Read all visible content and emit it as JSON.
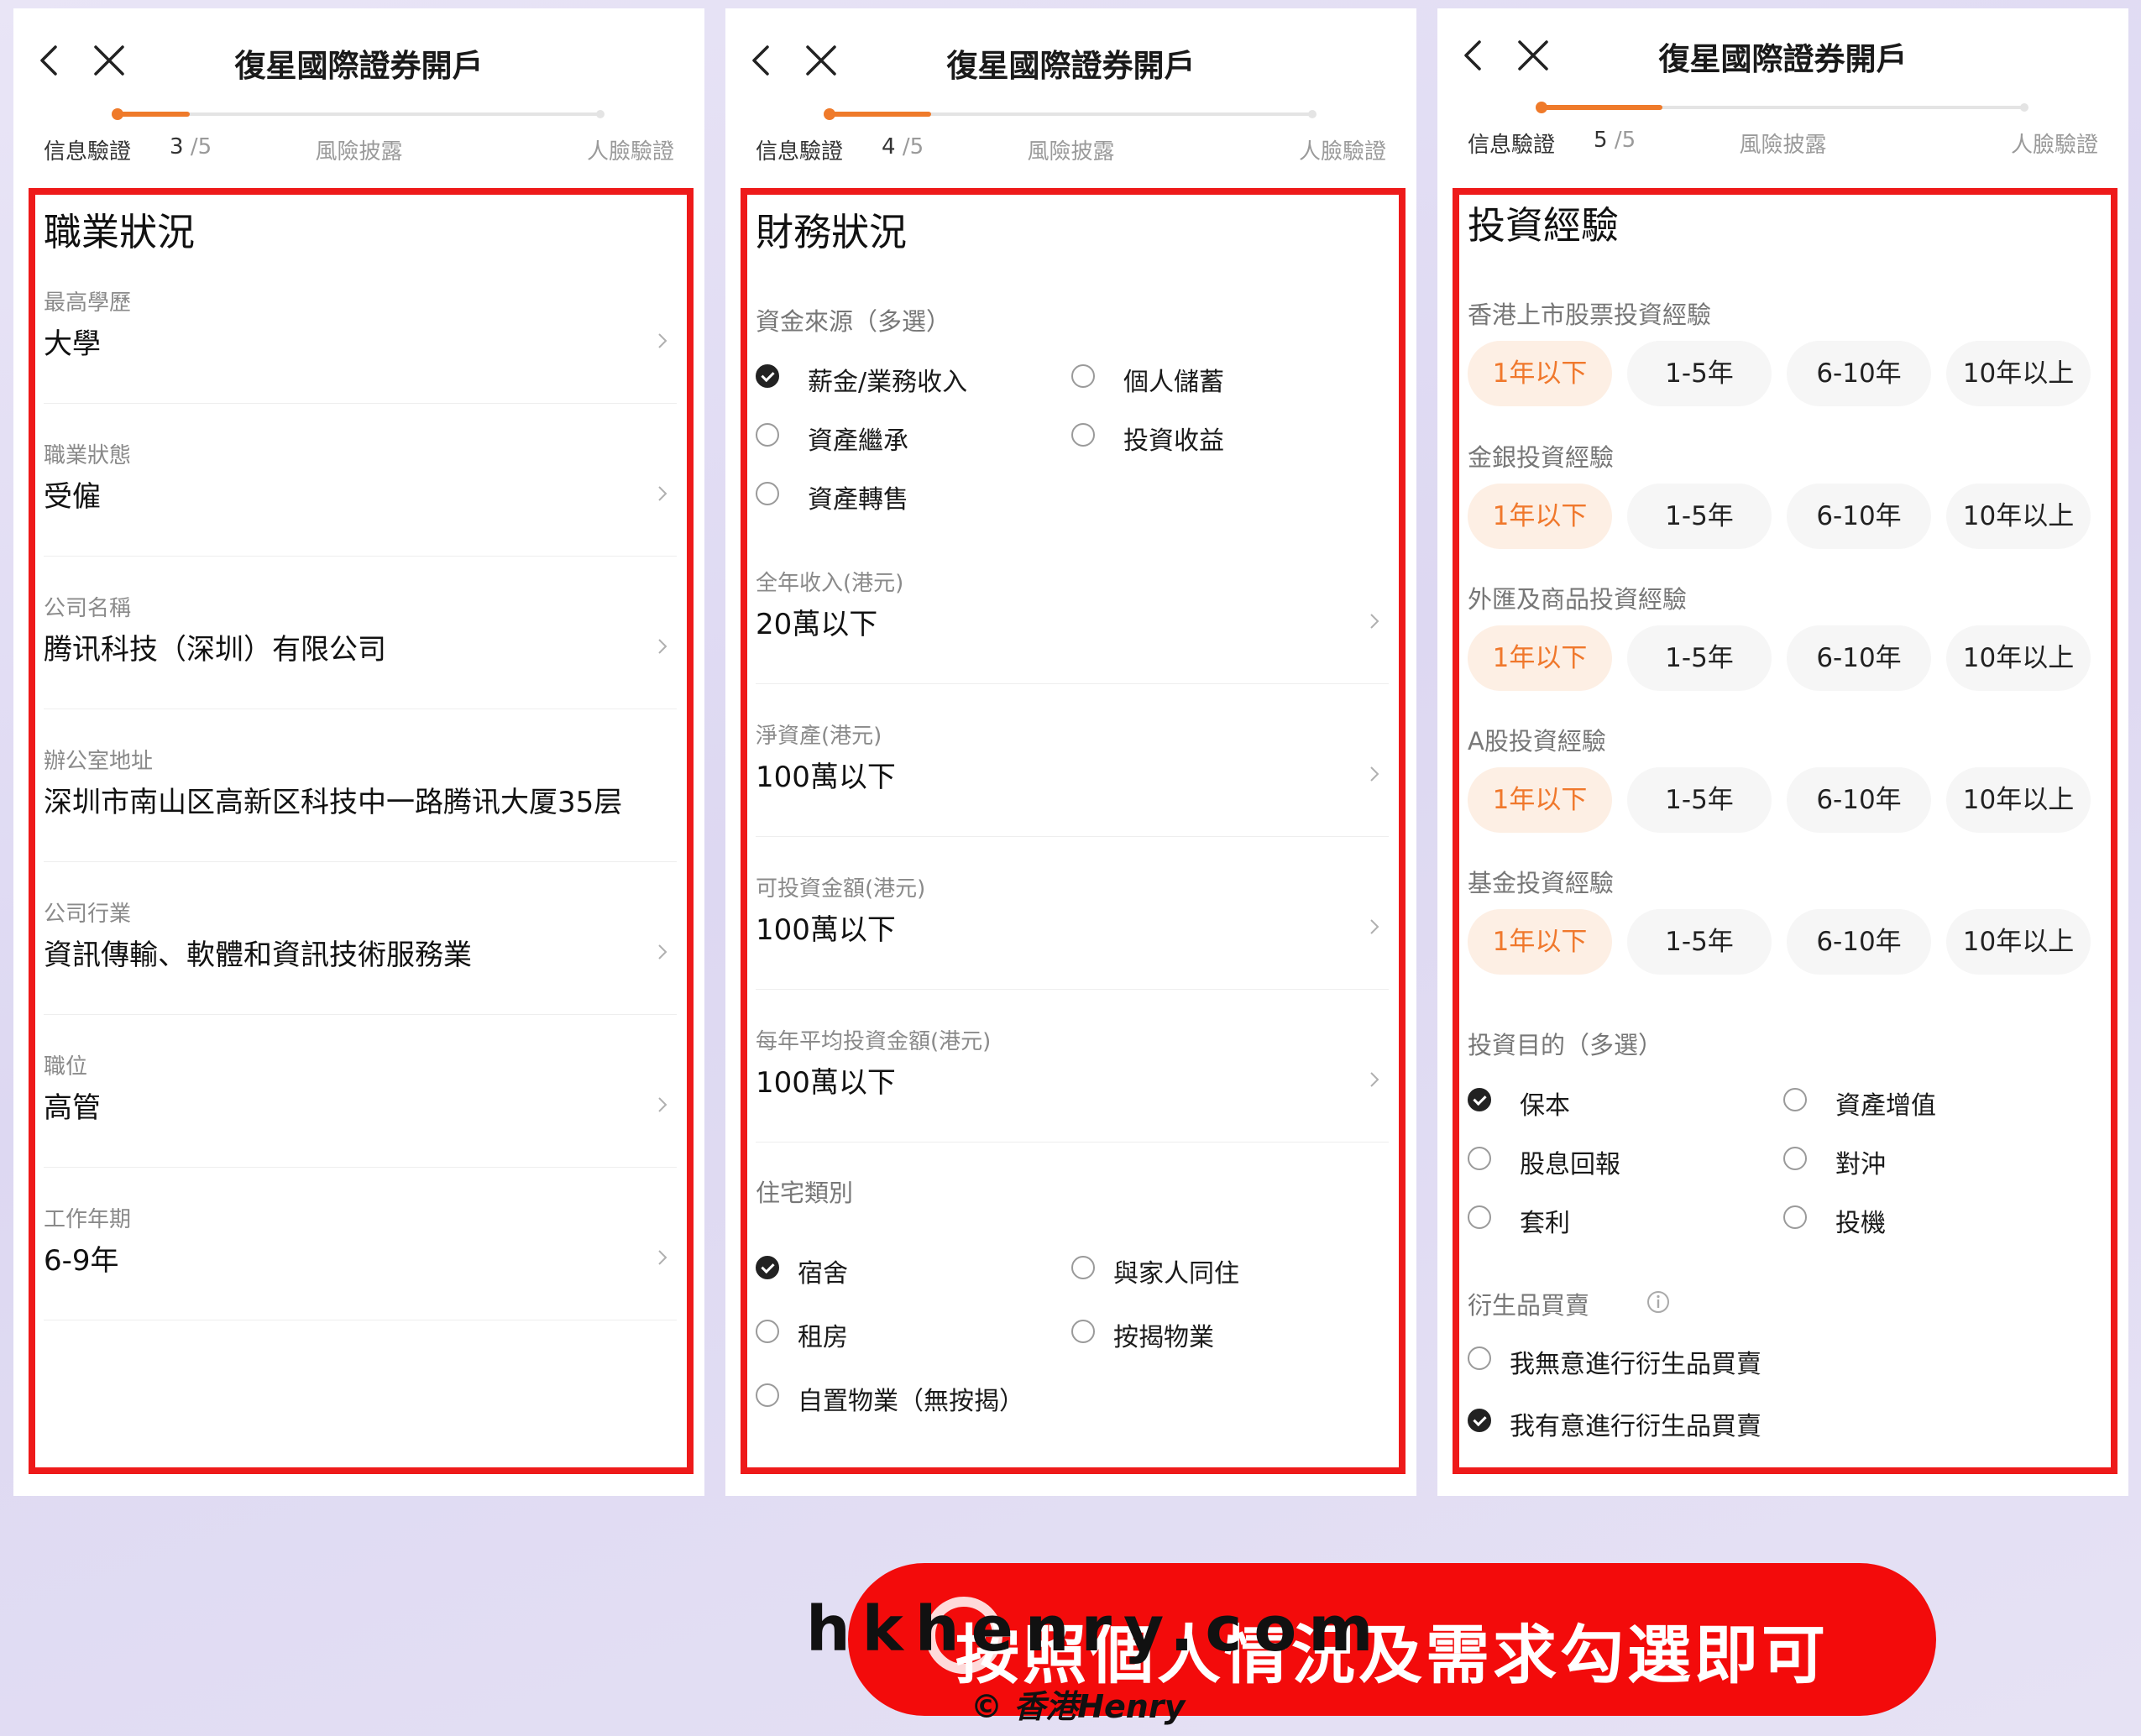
{
  "app_title": "復星國際證券開戶",
  "steps": {
    "step1": "信息驗證",
    "step2": "風險披露",
    "step3": "人臉驗證",
    "total": "/5"
  },
  "colors": {
    "accent": "#ef7a2a",
    "highlight_border": "#ee1a1a",
    "banner": "#f30b0b"
  },
  "icons": [
    "back-icon",
    "close-icon",
    "chevron-right-icon",
    "info-icon"
  ],
  "panels": [
    {
      "step_current": "3",
      "progress_fraction": 0.15,
      "section_title": "職業狀況",
      "fields": [
        {
          "label": "最高學歷",
          "value": "大學"
        },
        {
          "label": "職業狀態",
          "value": "受僱"
        },
        {
          "label": "公司名稱",
          "value": "腾讯科技（深圳）有限公司"
        },
        {
          "label": "辦公室地址",
          "value": "深圳市南山区高新区科技中一路腾讯大厦35层"
        },
        {
          "label": "公司行業",
          "value": "資訊傳輸、軟體和資訊技術服務業"
        },
        {
          "label": "職位",
          "value": "高管"
        },
        {
          "label": "工作年期",
          "value": "6-9年"
        }
      ]
    },
    {
      "step_current": "4",
      "progress_fraction": 0.21,
      "section_title": "財務狀況",
      "fund_source": {
        "label": "資金來源（多選）",
        "options": [
          {
            "text": "薪金/業務收入",
            "checked": true
          },
          {
            "text": "個人儲蓄",
            "checked": false
          },
          {
            "text": "資產繼承",
            "checked": false
          },
          {
            "text": "投資收益",
            "checked": false
          },
          {
            "text": "資產轉售",
            "checked": false
          }
        ]
      },
      "fields": [
        {
          "label": "全年收入(港元)",
          "value": "20萬以下"
        },
        {
          "label": "淨資產(港元)",
          "value": "100萬以下"
        },
        {
          "label": "可投資金額(港元)",
          "value": "100萬以下"
        },
        {
          "label": "每年平均投資金額(港元)",
          "value": "100萬以下"
        }
      ],
      "housing": {
        "label": "住宅類別",
        "options": [
          {
            "text": "宿舍",
            "checked": true
          },
          {
            "text": "與家人同住",
            "checked": false
          },
          {
            "text": "租房",
            "checked": false
          },
          {
            "text": "按揭物業",
            "checked": false
          },
          {
            "text": "自置物業（無按揭）",
            "checked": false
          }
        ]
      }
    },
    {
      "step_current": "5",
      "progress_fraction": 0.25,
      "section_title": "投資經驗",
      "experience": [
        {
          "label": "香港上市股票投資經驗",
          "options": [
            "1年以下",
            "1-5年",
            "6-10年",
            "10年以上"
          ],
          "selected": 0
        },
        {
          "label": "金銀投資經驗",
          "options": [
            "1年以下",
            "1-5年",
            "6-10年",
            "10年以上"
          ],
          "selected": 0
        },
        {
          "label": "外匯及商品投資經驗",
          "options": [
            "1年以下",
            "1-5年",
            "6-10年",
            "10年以上"
          ],
          "selected": 0
        },
        {
          "label": "A股投資經驗",
          "options": [
            "1年以下",
            "1-5年",
            "6-10年",
            "10年以上"
          ],
          "selected": 0
        },
        {
          "label": "基金投資經驗",
          "options": [
            "1年以下",
            "1-5年",
            "6-10年",
            "10年以上"
          ],
          "selected": 0
        }
      ],
      "purpose": {
        "label": "投資目的（多選）",
        "options": [
          {
            "text": "保本",
            "checked": true
          },
          {
            "text": "資產增值",
            "checked": false
          },
          {
            "text": "股息回報",
            "checked": false
          },
          {
            "text": "對沖",
            "checked": false
          },
          {
            "text": "套利",
            "checked": false
          },
          {
            "text": "投機",
            "checked": false
          }
        ]
      },
      "derivatives": {
        "label": "衍生品買賣",
        "options": [
          {
            "text": "我無意進行衍生品買賣",
            "checked": false
          },
          {
            "text": "我有意進行衍生品買賣",
            "checked": true
          }
        ]
      }
    }
  ],
  "banner": {
    "text": "按照個人情況及需求勾選即可"
  },
  "watermark": {
    "main": "hkhenry.com",
    "sub": "© 香港Henry"
  }
}
